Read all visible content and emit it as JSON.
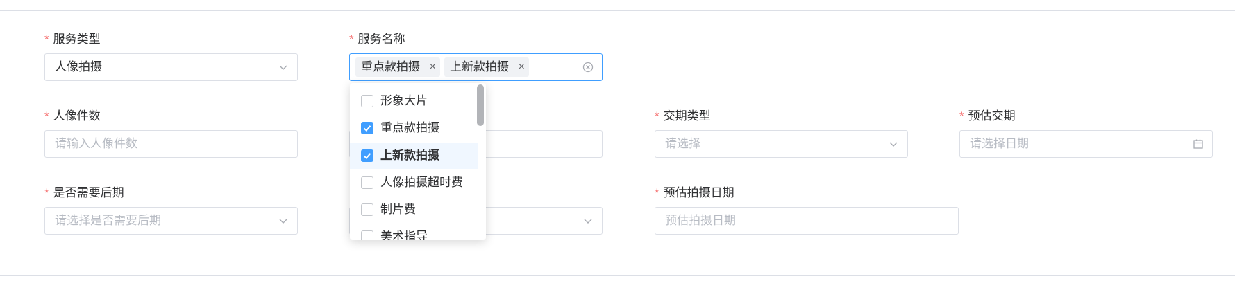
{
  "form": {
    "service_type": {
      "label": "服务类型",
      "value": "人像拍摄"
    },
    "service_name": {
      "label": "服务名称",
      "tags": [
        "重点款拍摄",
        "上新款拍摄"
      ],
      "tag_close": "×"
    },
    "portrait_count": {
      "label": "人像件数",
      "placeholder": "请输入人像件数"
    },
    "delivery_type": {
      "label": "交期类型",
      "placeholder": "请选择"
    },
    "estimated_delivery": {
      "label": "预估交期",
      "placeholder": "请选择日期"
    },
    "post_processing": {
      "label": "是否需要后期",
      "placeholder": "请选择是否需要后期"
    },
    "estimated_shoot_date": {
      "label": "预估拍摄日期",
      "placeholder": "预估拍摄日期"
    }
  },
  "required_mark": "*",
  "dropdown": {
    "options": [
      {
        "label": "形象大片",
        "checked": false,
        "highlighted": false
      },
      {
        "label": "重点款拍摄",
        "checked": true,
        "highlighted": false
      },
      {
        "label": "上新款拍摄",
        "checked": true,
        "highlighted": true
      },
      {
        "label": "人像拍摄超时费",
        "checked": false,
        "highlighted": false
      },
      {
        "label": "制片费",
        "checked": false,
        "highlighted": false
      },
      {
        "label": "美术指导",
        "checked": false,
        "highlighted": false
      }
    ]
  },
  "colors": {
    "required": "#f56c6c",
    "primary": "#409eff",
    "border": "#dcdfe6",
    "placeholder": "#b8bcc4"
  },
  "icons": {
    "select_suffix": "chevron-down-icon",
    "date_suffix": "calendar-icon",
    "clear": "circle-close-icon",
    "check": "check-icon"
  }
}
